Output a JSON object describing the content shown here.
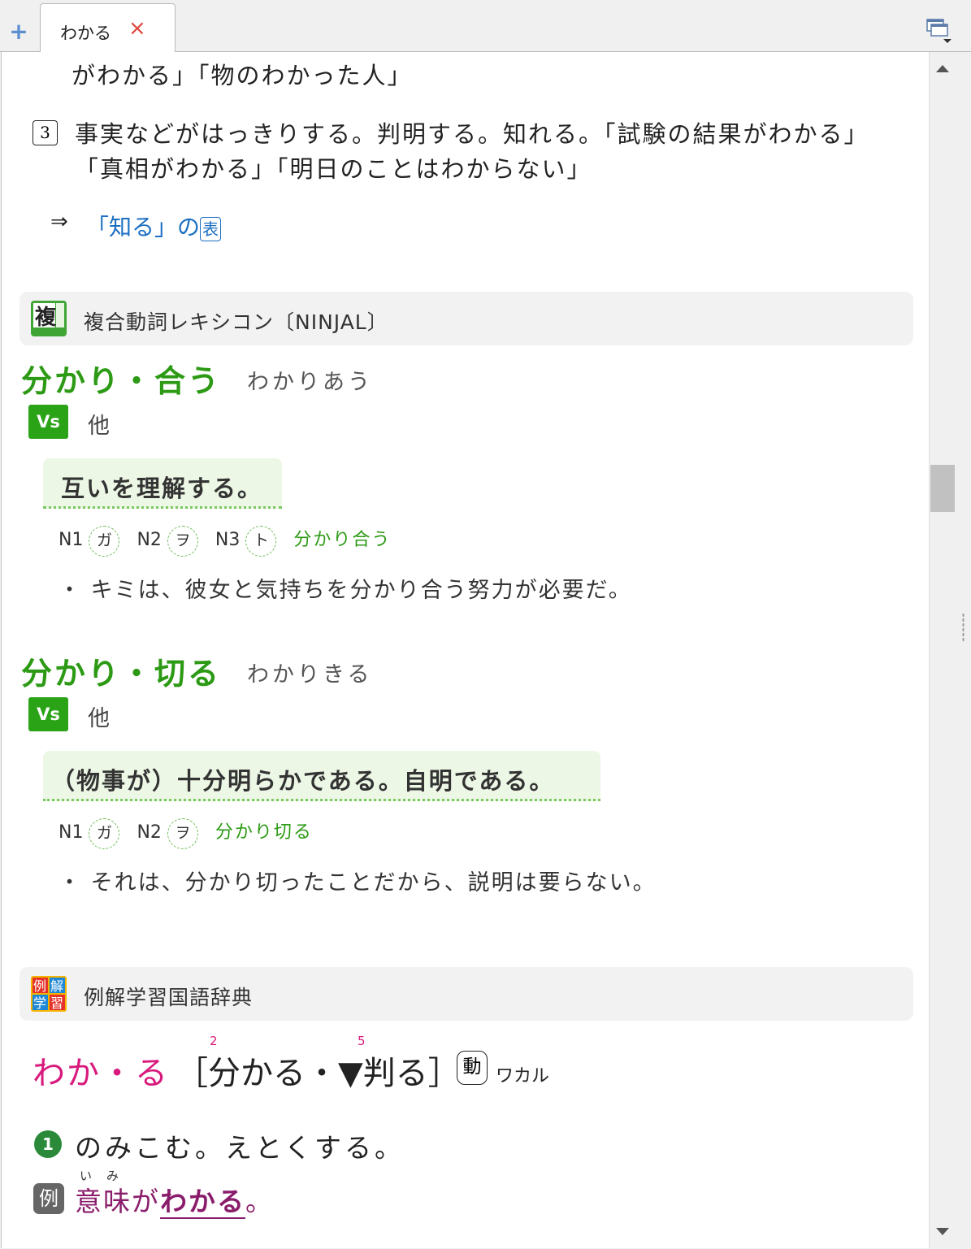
{
  "tabbar": {
    "tab_label": "わかる",
    "close_glyph": "×",
    "add_glyph": "+"
  },
  "entry1": {
    "line_top": "がわかる」「物のわかった人」",
    "sense3_num": "3",
    "sense3_line1": "事実などがはっきりする。判明する。知れる。「試験の結果がわかる」",
    "sense3_line2": "「真相がわかる」「明日のことはわからない」",
    "arrow": "⇒",
    "ref_link": "「知る」の",
    "ref_box": "表"
  },
  "ninjal": {
    "title": "複合動詞レキシコン〔NINJAL〕",
    "icon_char": "複",
    "entries": [
      {
        "headword": "分かり・合う",
        "reading": "わかりあう",
        "badge": "Vs",
        "transitivity": "他",
        "meaning": "互いを理解する。",
        "frame": {
          "n1": "N1",
          "p1": "ガ",
          "n2": "N2",
          "p2": "ヲ",
          "n3": "N3",
          "p3": "ト",
          "word": "分かり合う"
        },
        "example": "・ キミは、彼女と気持ちを分かり合う努力が必要だ。"
      },
      {
        "headword": "分かり・切る",
        "reading": "わかりきる",
        "badge": "Vs",
        "transitivity": "他",
        "meaning": "（物事が）十分明らかである。自明である。",
        "frame": {
          "n1": "N1",
          "p1": "ガ",
          "n2": "N2",
          "p2": "ヲ",
          "word": "分かり切る"
        },
        "example": "・ それは、分かり切ったことだから、説明は要らない。"
      }
    ]
  },
  "reikai": {
    "title": "例解学習国語辞典",
    "icon_chars": [
      "例",
      "解",
      "学",
      "習"
    ],
    "headword": "わか・る",
    "kanji_form": "［分かる・▼判る］",
    "grade_1": "2",
    "grade_2": "5",
    "pos": "動",
    "katakana": "ワカル",
    "def_num": "1",
    "def_text": "のみこむ。えとくする。",
    "example_label": "例",
    "example_ruby": "いみ",
    "example_pre": "意味が",
    "example_hl": "わかる",
    "example_post": "。"
  },
  "colors": {
    "green": "#2c9a14",
    "pink": "#d81a7d",
    "link_blue": "#1d6fc2",
    "example_purple": "#8a1d6b"
  }
}
